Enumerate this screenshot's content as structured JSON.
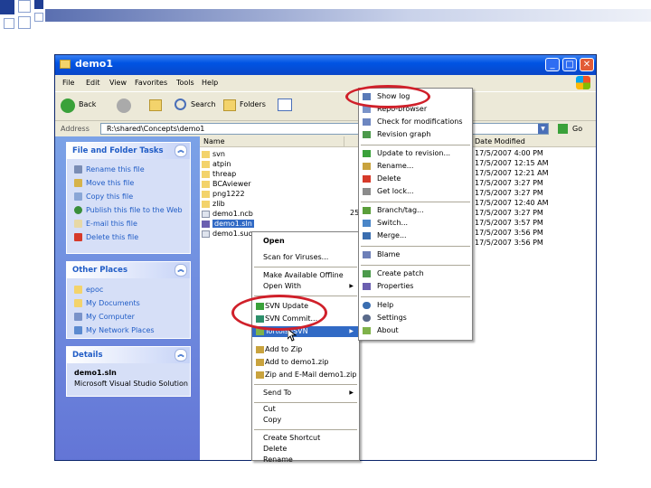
{
  "window": {
    "title": "demo1",
    "min": "_",
    "max": "□",
    "close": "✕"
  },
  "menubar": [
    "File",
    "Edit",
    "View",
    "Favorites",
    "Tools",
    "Help"
  ],
  "toolbar": {
    "back": "Back",
    "search": "Search",
    "folders": "Folders"
  },
  "address": {
    "label": "Address",
    "value": "R:\\shared\\Concepts\\demo1",
    "go": "Go"
  },
  "tasks": {
    "file_folder": {
      "title": "File and Folder Tasks",
      "items": [
        "Rename this file",
        "Move this file",
        "Copy this file",
        "Publish this file to the Web",
        "E-mail this file",
        "Delete this file"
      ]
    },
    "other_places": {
      "title": "Other Places",
      "items": [
        "epoc",
        "My Documents",
        "My Computer",
        "My Network Places"
      ]
    },
    "details": {
      "title": "Details",
      "filename": "demo1.sln",
      "filetype": "Microsoft Visual Studio Solution"
    }
  },
  "columns": {
    "name": "Name",
    "date": "Date Modified"
  },
  "files": [
    {
      "name": "svn"
    },
    {
      "name": "atpin"
    },
    {
      "name": "threap"
    },
    {
      "name": "BCAviewer"
    },
    {
      "name": "png1222"
    },
    {
      "name": "zlib"
    },
    {
      "name": "demo1.ncb",
      "size": "25"
    },
    {
      "name": "demo1.sln"
    },
    {
      "name": "demo1.suo"
    }
  ],
  "dates": [
    "17/5/2007 4:00 PM",
    "17/5/2007 12:15 AM",
    "17/5/2007 12:21 AM",
    "17/5/2007 3:27 PM",
    "17/5/2007 3:27 PM",
    "17/5/2007 12:40 AM",
    "17/5/2007 3:27 PM",
    "17/5/2007 3:57 PM",
    "17/5/2007 3:56 PM",
    "17/5/2007 3:56 PM"
  ],
  "context_menu": {
    "items": [
      "Open",
      "Scan for Viruses...",
      "Make Available Offline",
      "Open With",
      "SVN Update",
      "SVN Commit...",
      "TortoiseSVN",
      "Add to Zip",
      "Add to demo1.zip",
      "Zip and E-Mail demo1.zip",
      "Send To",
      "Cut",
      "Copy",
      "Create Shortcut",
      "Delete",
      "Rename"
    ]
  },
  "submenu": {
    "items": [
      "Show log",
      "Repo-browser",
      "Check for modifications",
      "Revision graph",
      "Update to revision...",
      "Rename...",
      "Delete",
      "Get lock...",
      "Branch/tag...",
      "Switch...",
      "Merge...",
      "Blame",
      "Create patch",
      "Properties",
      "Help",
      "Settings",
      "About"
    ]
  },
  "colors": {
    "titlebar": "#0054e3",
    "taskpane": "#6375d6",
    "link": "#215dc6",
    "highlight": "#316ac5",
    "ring": "#d0202a"
  }
}
